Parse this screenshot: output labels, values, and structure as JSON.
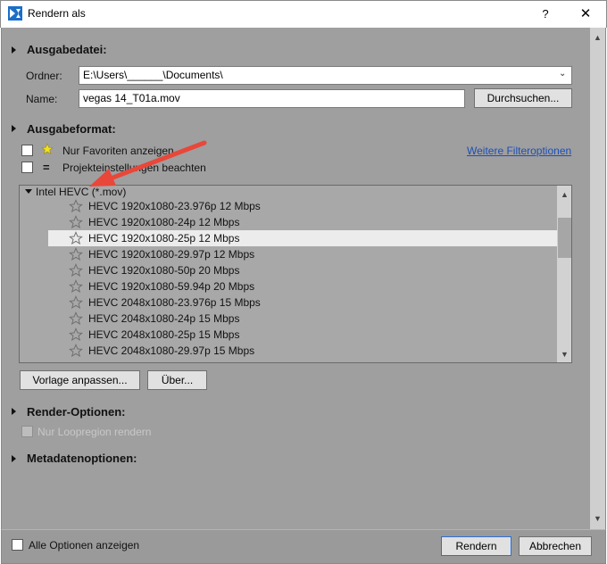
{
  "window": {
    "title": "Rendern als",
    "help_label": "?",
    "close_label": "✕"
  },
  "output_file": {
    "section_title": "Ausgabedatei:",
    "folder_label": "Ordner:",
    "folder_value": "E:\\Users\\______\\Documents\\",
    "name_label": "Name:",
    "name_value": "vegas 14_T01a.mov",
    "browse_label": "Durchsuchen..."
  },
  "output_format": {
    "section_title": "Ausgabeformat:",
    "favorites_label": "Nur Favoriten anzeigen",
    "project_settings_label": "Projekteinstellungen beachten",
    "more_filters_link": "Weitere Filteroptionen",
    "group_label": "Intel HEVC (*.mov)",
    "templates": [
      "HEVC 1920x1080-23.976p 12 Mbps",
      "HEVC 1920x1080-24p 12 Mbps",
      "HEVC 1920x1080-25p 12 Mbps",
      "HEVC 1920x1080-29.97p 12 Mbps",
      "HEVC 1920x1080-50p 20 Mbps",
      "HEVC 1920x1080-59.94p 20 Mbps",
      "HEVC 2048x1080-23.976p 15 Mbps",
      "HEVC 2048x1080-24p 15 Mbps",
      "HEVC 2048x1080-25p 15 Mbps",
      "HEVC 2048x1080-29.97p 15 Mbps"
    ],
    "selected_template": "HEVC 1920x1080-25p 12 Mbps",
    "customize_label": "Vorlage anpassen...",
    "about_label": "Über..."
  },
  "render_options": {
    "section_title": "Render-Optionen:",
    "loop_region_label": "Nur Loopregion rendern"
  },
  "metadata_options": {
    "section_title": "Metadatenoptionen:"
  },
  "footer": {
    "show_all_label": "Alle Optionen anzeigen",
    "render_label": "Rendern",
    "cancel_label": "Abbrechen"
  },
  "colors": {
    "panel": "#9f9f9f",
    "selected_row": "#ececec",
    "link": "#1c4fb8",
    "annotation_arrow": "#e8473a"
  }
}
